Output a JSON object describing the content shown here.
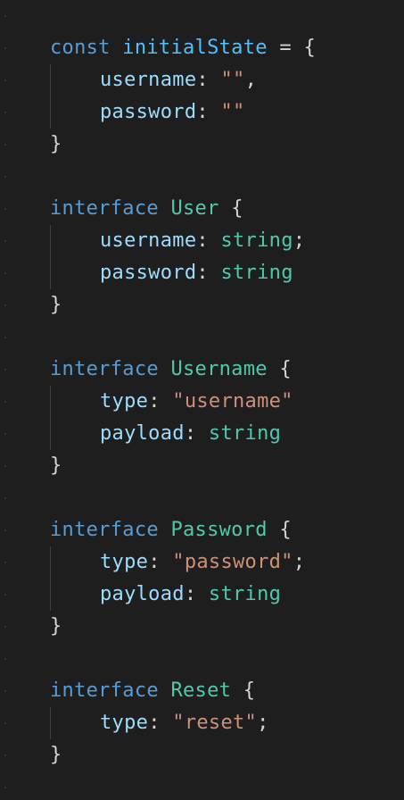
{
  "editor": {
    "theme_colors": {
      "background": "#1e1e1e",
      "keyword": "#569cd6",
      "variable": "#4fc1ff",
      "type": "#4ec9b0",
      "property": "#9cdcfe",
      "string": "#ce9178",
      "punctuation": "#d4d4d4"
    },
    "blocks": [
      {
        "keyword": "const",
        "name": "initialState",
        "equals": " = ",
        "open": "{",
        "fields": [
          {
            "key": "username",
            "colon": ": ",
            "value": "\"\"",
            "end": ","
          },
          {
            "key": "password",
            "colon": ": ",
            "value": "\"\"",
            "end": ""
          }
        ],
        "close": "}"
      },
      {
        "keyword": "interface",
        "name": "User",
        "open": "{",
        "fields": [
          {
            "key": "username",
            "colon": ": ",
            "value": "string",
            "end": ";"
          },
          {
            "key": "password",
            "colon": ": ",
            "value": "string",
            "end": ""
          }
        ],
        "close": "}"
      },
      {
        "keyword": "interface",
        "name": "Username",
        "open": "{",
        "fields": [
          {
            "key": "type",
            "colon": ": ",
            "value": "\"username\"",
            "end": ""
          },
          {
            "key": "payload",
            "colon": ": ",
            "value": "string",
            "end": ""
          }
        ],
        "close": "}"
      },
      {
        "keyword": "interface",
        "name": "Password",
        "open": "{",
        "fields": [
          {
            "key": "type",
            "colon": ": ",
            "value": "\"password\"",
            "end": ";"
          },
          {
            "key": "payload",
            "colon": ": ",
            "value": "string",
            "end": ""
          }
        ],
        "close": "}"
      },
      {
        "keyword": "interface",
        "name": "Reset",
        "open": "{",
        "fields": [
          {
            "key": "type",
            "colon": ": ",
            "value": "\"reset\"",
            "end": ";"
          }
        ],
        "close": "}"
      }
    ]
  }
}
